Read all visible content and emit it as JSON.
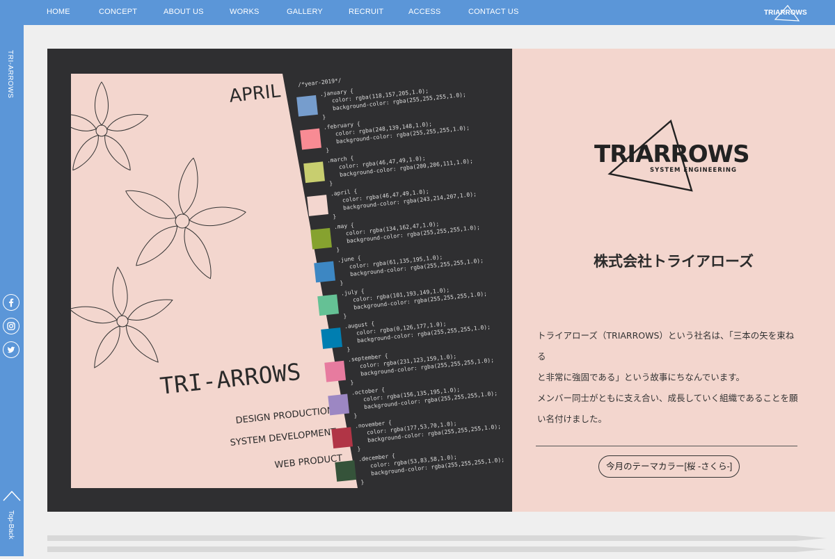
{
  "nav": {
    "items": [
      "HOME",
      "CONCEPT",
      "ABOUT US",
      "WORKS",
      "GALLERY",
      "RECRUIT",
      "ACCESS",
      "CONTACT US"
    ],
    "logo_text": "TRIARROWS"
  },
  "sidebar": {
    "title": "TRI-ARROWS",
    "topback": "Top-Back"
  },
  "poster": {
    "month": "APRIL",
    "brand": "TRI-ARROWS",
    "lines": [
      "DESIGN PRODUCTION",
      "SYSTEM DEVELOPMENT",
      "WEB PRODUCT"
    ]
  },
  "code": {
    "header": "/*year-2019*/",
    "months": [
      {
        "name": ".january {",
        "color": "color: rgba(118,157,205,1.0);",
        "bg": "background-color: rgba(255,255,255,1.0);",
        "swatch": "#769dcd"
      },
      {
        "name": ".february {",
        "color": "color: rgba(248,139,148,1.0);",
        "bg": "background-color: rgba(255,255,255,1.0);",
        "swatch": "#f88b94"
      },
      {
        "name": ".march {",
        "color": "color: rgba(46,47,49,1.0);",
        "bg": "background-color: rgba(200,206,111,1.0);",
        "swatch": "#c8ce6f"
      },
      {
        "name": ".april {",
        "color": "color: rgba(46,47,49,1.0);",
        "bg": "background-color: rgba(243,214,207,1.0);",
        "swatch": "#f3d6cf"
      },
      {
        "name": ".may {",
        "color": "color: rgba(134,162,47,1.0);",
        "bg": "background-color: rgba(255,255,255,1.0);",
        "swatch": "#86a22f"
      },
      {
        "name": ".june {",
        "color": "color: rgba(61,135,195,1.0);",
        "bg": "background-color: rgba(255,255,255,1.0);",
        "swatch": "#3d87c3"
      },
      {
        "name": ".july {",
        "color": "color: rgba(101,193,149,1.0);",
        "bg": "background-color: rgba(255,255,255,1.0);",
        "swatch": "#65c195"
      },
      {
        "name": ".august {",
        "color": "color: rgba(0,126,177,1.0);",
        "bg": "background-color: rgba(255,255,255,1.0);",
        "swatch": "#007eb1"
      },
      {
        "name": ".september {",
        "color": "color: rgba(231,123,159,1.0);",
        "bg": "background-color: rgba(255,255,255,1.0);",
        "swatch": "#e77b9f"
      },
      {
        "name": ".october {",
        "color": "color: rgba(156,135,195,1.0);",
        "bg": "background-color: rgba(255,255,255,1.0);",
        "swatch": "#9c87c3"
      },
      {
        "name": ".november {",
        "color": "color: rgba(177,53,70,1.0);",
        "bg": "background-color: rgba(255,255,255,1.0);",
        "swatch": "#b13546"
      },
      {
        "name": ".december {",
        "color": "color: rgba(53,83,58,1.0);",
        "bg": "background-color: rgba(255,255,255,1.0);",
        "swatch": "#35533a"
      }
    ],
    "close": "}"
  },
  "about": {
    "logo_main": "TRIARROWS",
    "logo_sub": "SYSTEM ENGINEERING",
    "company": "株式会社トライアローズ",
    "desc_lines": [
      "トライアローズ（TRIARROWS）という社名は、「三本の矢を束ねる",
      "と非常に強固である」という故事にちなんでいます。",
      "メンバー同士がともに支え合い、成長していく組織であることを願",
      "い名付けました。"
    ],
    "theme_button": "今月のテーマカラー[桜 -さくら-]"
  },
  "colors": {
    "accent": "#5b96d8",
    "poster_bg": "#f3d6ce",
    "dark_bg": "#2f2f31"
  }
}
